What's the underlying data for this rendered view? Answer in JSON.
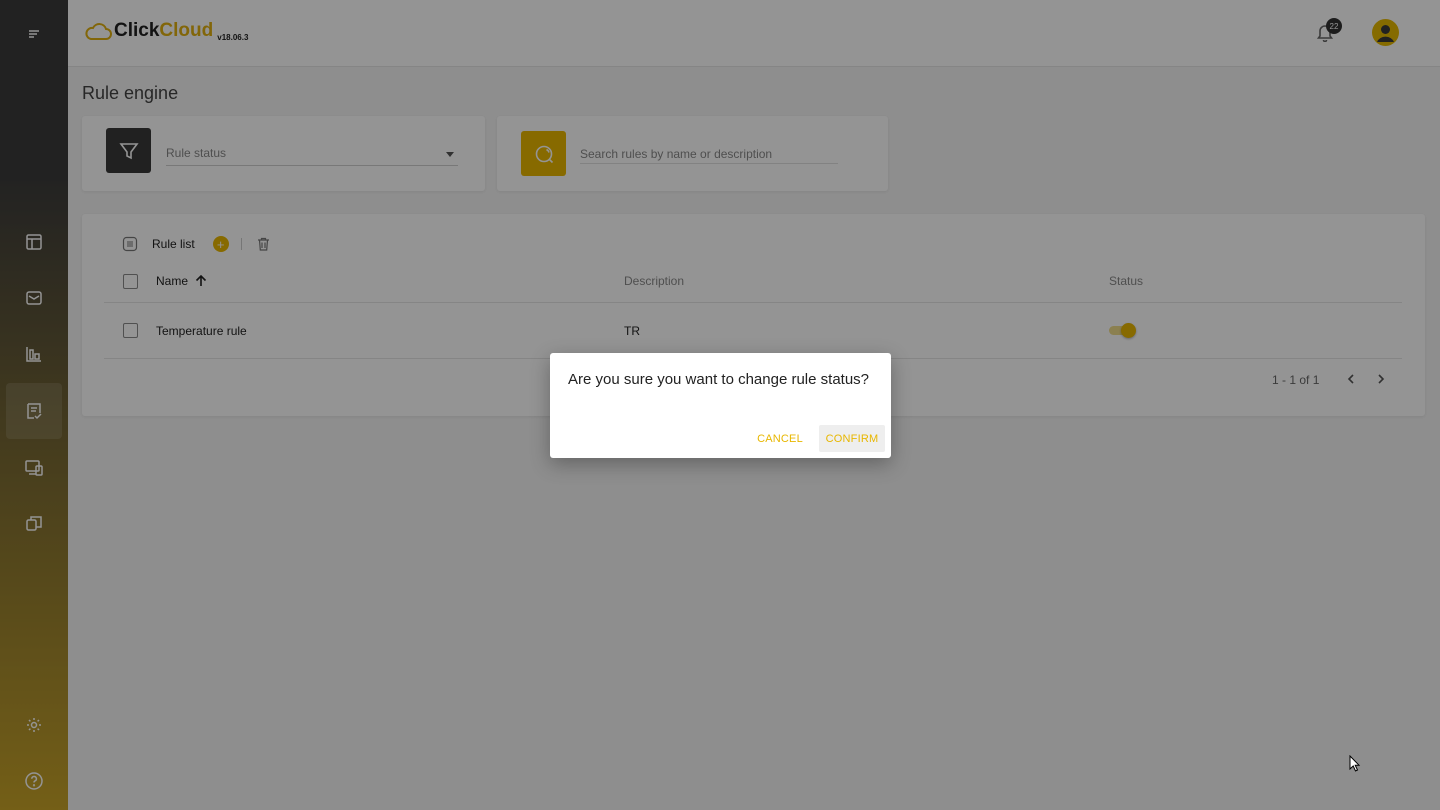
{
  "app": {
    "brand_part1": "Click",
    "brand_part2": "Cloud",
    "version": "v18.06.3",
    "notification_count": "22",
    "accent_color": "#e8b700"
  },
  "sidebar": {
    "items": [
      {
        "icon": "menu-icon"
      },
      {
        "icon": "dashboard-icon"
      },
      {
        "icon": "mail-icon"
      },
      {
        "icon": "chart-icon"
      },
      {
        "icon": "rule-icon",
        "active": true
      },
      {
        "icon": "devices-icon"
      },
      {
        "icon": "copy-icon"
      },
      {
        "icon": "gear-icon"
      },
      {
        "icon": "help-icon"
      }
    ]
  },
  "page": {
    "title": "Rule engine"
  },
  "filter": {
    "select_placeholder": "Rule status"
  },
  "search": {
    "placeholder": "Search rules by name or description"
  },
  "rule_list": {
    "title": "Rule list",
    "columns": {
      "name": "Name",
      "description": "Description",
      "status": "Status"
    },
    "rows": [
      {
        "name": "Temperature rule",
        "description": "TR",
        "status_on": true
      }
    ],
    "pagination": "1 - 1 of 1"
  },
  "dialog": {
    "message": "Are you sure you want to change rule status?",
    "cancel_label": "CANCEL",
    "confirm_label": "CONFIRM"
  }
}
